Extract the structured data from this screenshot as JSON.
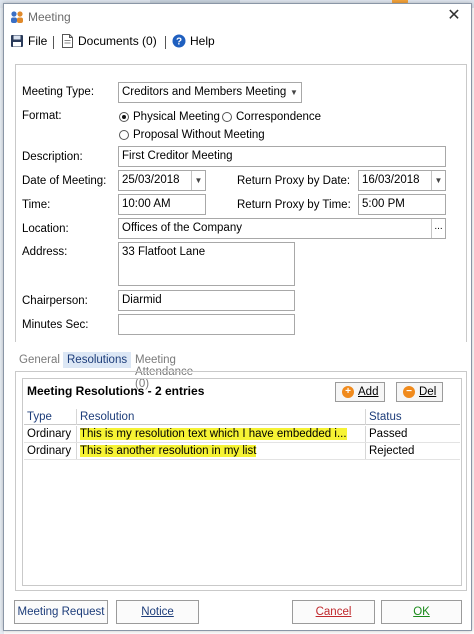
{
  "window": {
    "title": "Meeting",
    "close_glyph": "✕"
  },
  "menu": {
    "file_label": "File",
    "documents_label": "Documents (0)",
    "help_label": "Help"
  },
  "form": {
    "meeting_type_label": "Meeting Type:",
    "meeting_type_value": "Creditors and Members Meeting",
    "format_label": "Format:",
    "format_options": [
      {
        "label": "Physical Meeting",
        "selected": true
      },
      {
        "label": "Correspondence",
        "selected": false
      },
      {
        "label": "Proposal Without Meeting",
        "selected": false
      }
    ],
    "description_label": "Description:",
    "description_value": "First Creditor Meeting",
    "date_label": "Date of Meeting:",
    "date_value": "25/03/2018",
    "return_proxy_date_label": "Return Proxy by Date:",
    "return_proxy_date_value": "16/03/2018",
    "time_label": "Time:",
    "time_value": "10:00 AM",
    "return_proxy_time_label": "Return Proxy by Time:",
    "return_proxy_time_value": "5:00 PM",
    "location_label": "Location:",
    "location_value": "Offices of the Company",
    "location_button": "...",
    "address_label": "Address:",
    "address_value": "33 Flatfoot Lane",
    "chairperson_label": "Chairperson:",
    "chairperson_value": "Diarmid",
    "minutes_label": "Minutes Sec:",
    "minutes_value": ""
  },
  "tabs": [
    {
      "label": "General",
      "active": false
    },
    {
      "label": "Resolutions",
      "active": true
    },
    {
      "label": "Meeting Attendance (0)",
      "active": false
    }
  ],
  "resolutions": {
    "title": "Meeting Resolutions - 2 entries",
    "add_label": "Add",
    "del_label": "Del",
    "columns": [
      "Type",
      "Resolution",
      "Status"
    ],
    "rows": [
      {
        "type": "Ordinary",
        "resolution": "This is my resolution text which I have embedded i...",
        "status": "Passed"
      },
      {
        "type": "Ordinary",
        "resolution": "This is another resolution in my list",
        "status": "Rejected"
      }
    ]
  },
  "footer": {
    "meeting_request": "Meeting Request",
    "notice": "Notice",
    "cancel": "Cancel",
    "ok": "OK"
  },
  "colors": {
    "highlight": "#f6f334",
    "ok_text": "#1a8a1a",
    "cancel_text": "#c0282c",
    "link_blue": "#1d3d7a"
  }
}
